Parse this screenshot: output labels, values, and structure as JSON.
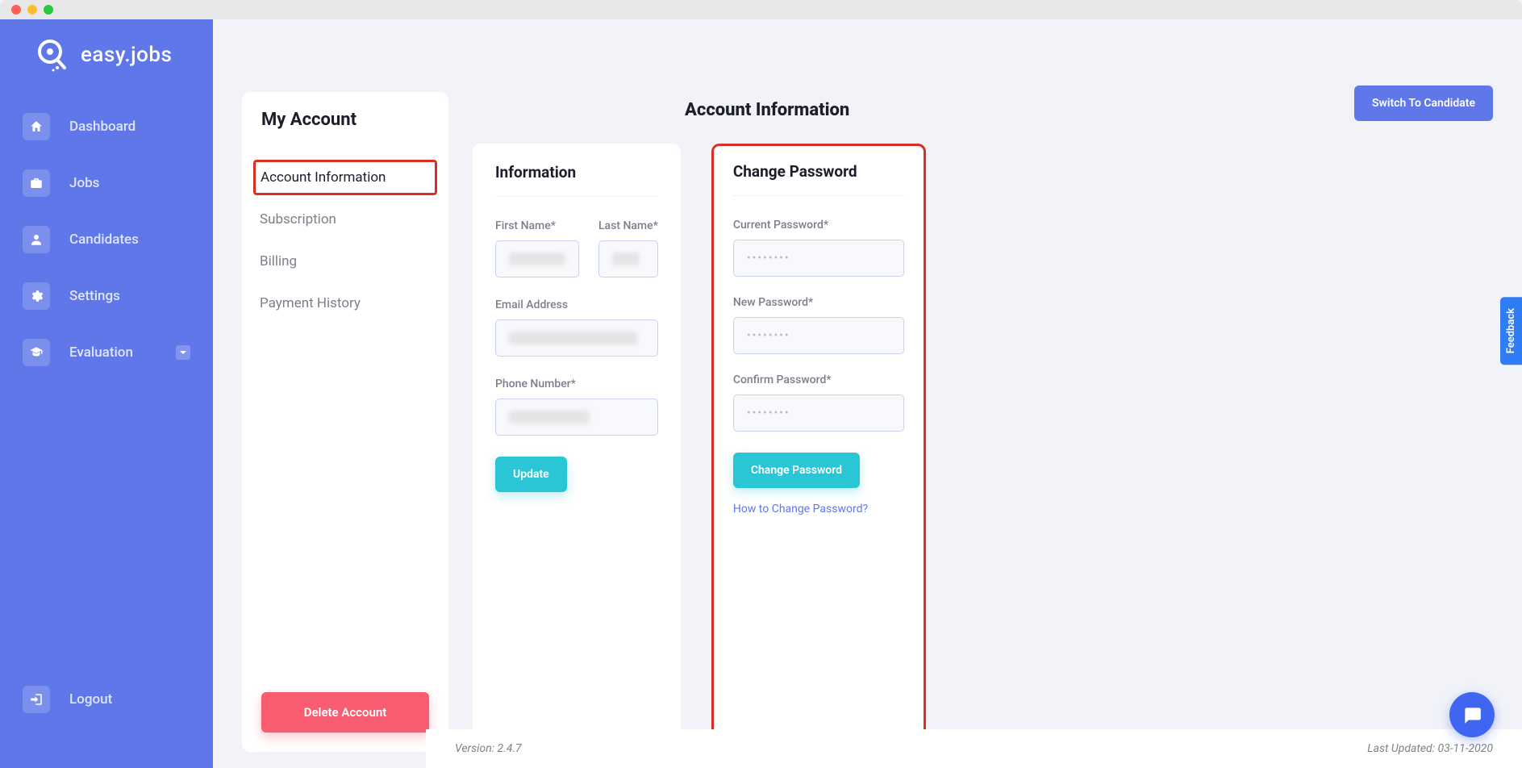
{
  "brand": "easy.jobs",
  "sidebar": {
    "items": [
      {
        "label": "Dashboard",
        "icon": "home-icon"
      },
      {
        "label": "Jobs",
        "icon": "briefcase-icon"
      },
      {
        "label": "Candidates",
        "icon": "user-icon"
      },
      {
        "label": "Settings",
        "icon": "gear-icon"
      },
      {
        "label": "Evaluation",
        "icon": "graduation-icon"
      }
    ],
    "logout": "Logout"
  },
  "subnav": {
    "title": "My Account",
    "items": [
      "Account Information",
      "Subscription",
      "Billing",
      "Payment History"
    ],
    "delete_label": "Delete Account"
  },
  "page_title": "Account Information",
  "switch_label": "Switch To Candidate",
  "info_card": {
    "title": "Information",
    "first_name_label": "First Name*",
    "last_name_label": "Last Name*",
    "email_label": "Email Address",
    "phone_label": "Phone Number*",
    "update_label": "Update"
  },
  "pwd_card": {
    "title": "Change Password",
    "current_label": "Current Password*",
    "new_label": "New Password*",
    "confirm_label": "Confirm Password*",
    "placeholder": "••••••••",
    "change_label": "Change Password",
    "howto_label": "How to Change Password?"
  },
  "footer": {
    "version_label": "Version: 2.4.7",
    "updated_label": "Last Updated: 03-11-2020"
  },
  "feedback_label": "Feedback"
}
